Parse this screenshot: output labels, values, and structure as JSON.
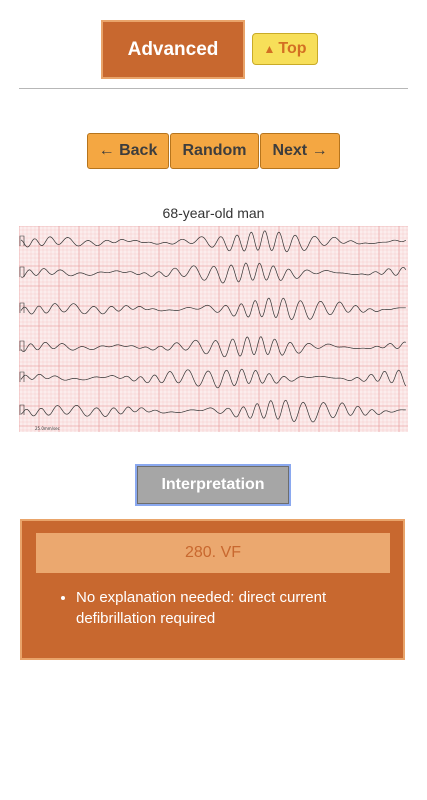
{
  "header": {
    "level_label": "Advanced",
    "top_arrow": "▲",
    "top_label": "Top"
  },
  "nav": {
    "back_label": "← Back",
    "random_label": "Random",
    "next_label": "Next →"
  },
  "case": {
    "patient": "68-year-old man",
    "ecg_leads": [
      "I",
      "II",
      "III",
      "aVR",
      "aVL",
      "aVF",
      "V1",
      "V2",
      "V3",
      "V4",
      "V5",
      "V6"
    ],
    "ecg_footer": "25.0mm/sec"
  },
  "interpretation": {
    "button_label": "Interpretation",
    "diagnosis": "280. VF",
    "explanations": [
      "No explanation needed: direct current defibrillation required"
    ]
  },
  "colors": {
    "primary": "#c8682f",
    "accent_light": "#eba86f",
    "nav_button": "#f4a742",
    "top_button": "#f7df59",
    "interp_button": "#a6a6a6",
    "ecg_grid": "#f3b9b9",
    "ecg_paper": "#fbeded"
  }
}
